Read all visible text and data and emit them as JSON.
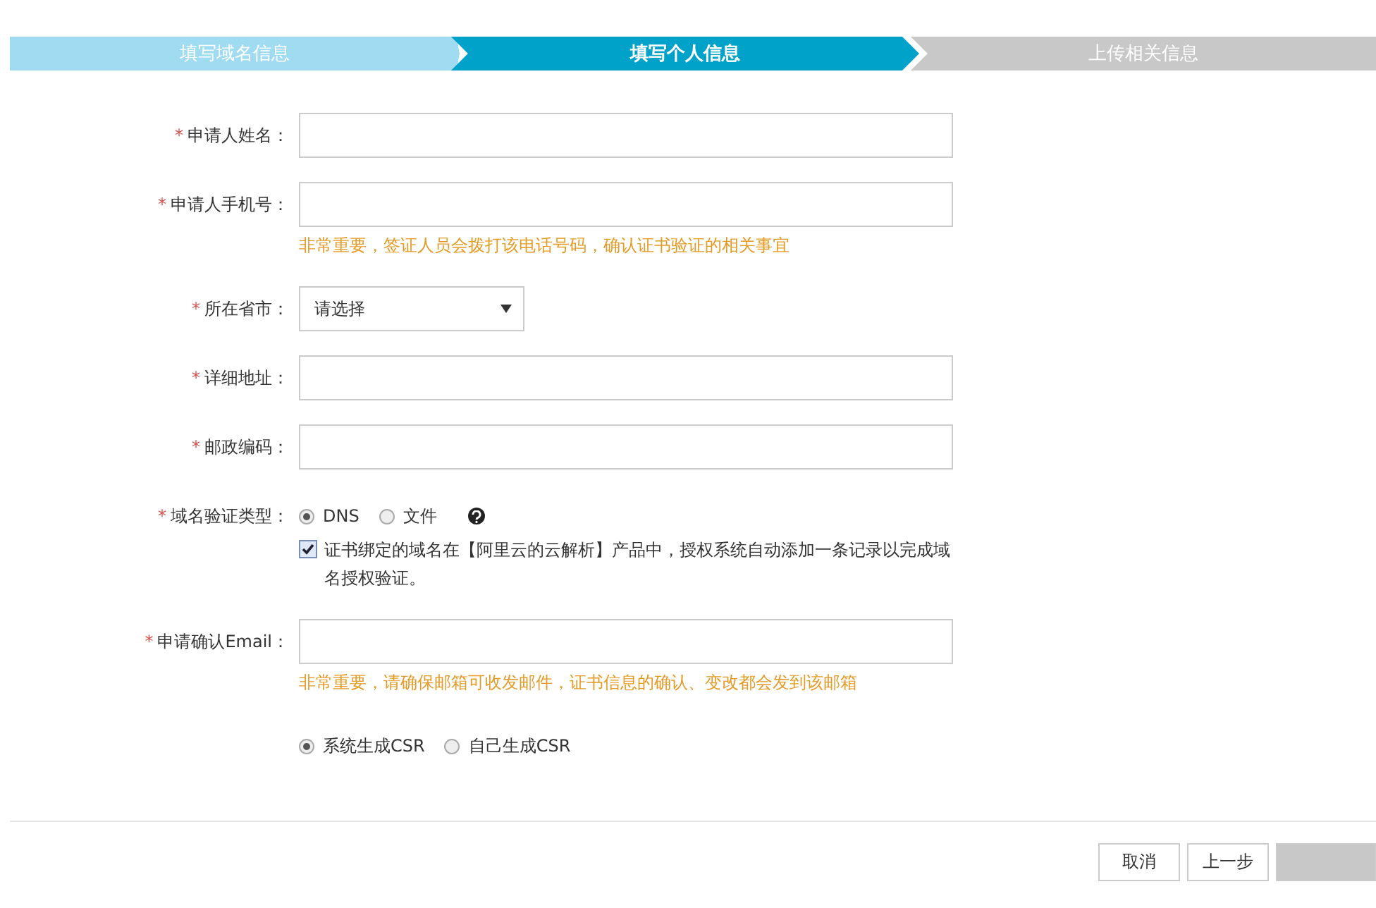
{
  "steps": [
    {
      "label": "填写域名信息",
      "selected": false,
      "completed": true
    },
    {
      "label": "填写个人信息",
      "selected": true,
      "completed": false
    },
    {
      "label": "上传相关信息",
      "selected": false,
      "completed": false
    }
  ],
  "form": [
    {
      "kind": "input",
      "required": true,
      "label": "申请人姓名："
    },
    {
      "kind": "input",
      "required": true,
      "label": "申请人手机号：",
      "hint": "非常重要，签证人员会拨打该电话号码，确认证书验证的相关事宜"
    },
    {
      "kind": "select",
      "required": true,
      "label": "所在省市：",
      "value": "请选择"
    },
    {
      "kind": "input",
      "required": true,
      "label": "详细地址："
    },
    {
      "kind": "input",
      "required": true,
      "label": "邮政编码："
    },
    {
      "kind": "radio",
      "required": true,
      "label": "域名验证类型：",
      "options": [
        {
          "label": "DNS",
          "selected": true
        },
        {
          "label": "文件",
          "selected": false
        }
      ],
      "help": true,
      "checkbox": {
        "checked": true,
        "text": "证书绑定的域名在【阿里云的云解析】产品中，授权系统自动添加一条记录以完成域名授权验证。"
      }
    },
    {
      "kind": "input",
      "required": true,
      "label": "申请确认Email：",
      "hint": "非常重要，请确保邮箱可收发邮件，证书信息的确认、变改都会发到该邮箱"
    },
    {
      "kind": "radio",
      "options": [
        {
          "label": "系统生成CSR",
          "selected": true
        },
        {
          "label": "自己生成CSR",
          "selected": false
        }
      ]
    }
  ],
  "required_mark": "*",
  "buttons": [
    {
      "label": "取消",
      "kind": "plain"
    },
    {
      "label": "上一步",
      "kind": "plain"
    },
    {
      "kind": "disabled"
    }
  ]
}
